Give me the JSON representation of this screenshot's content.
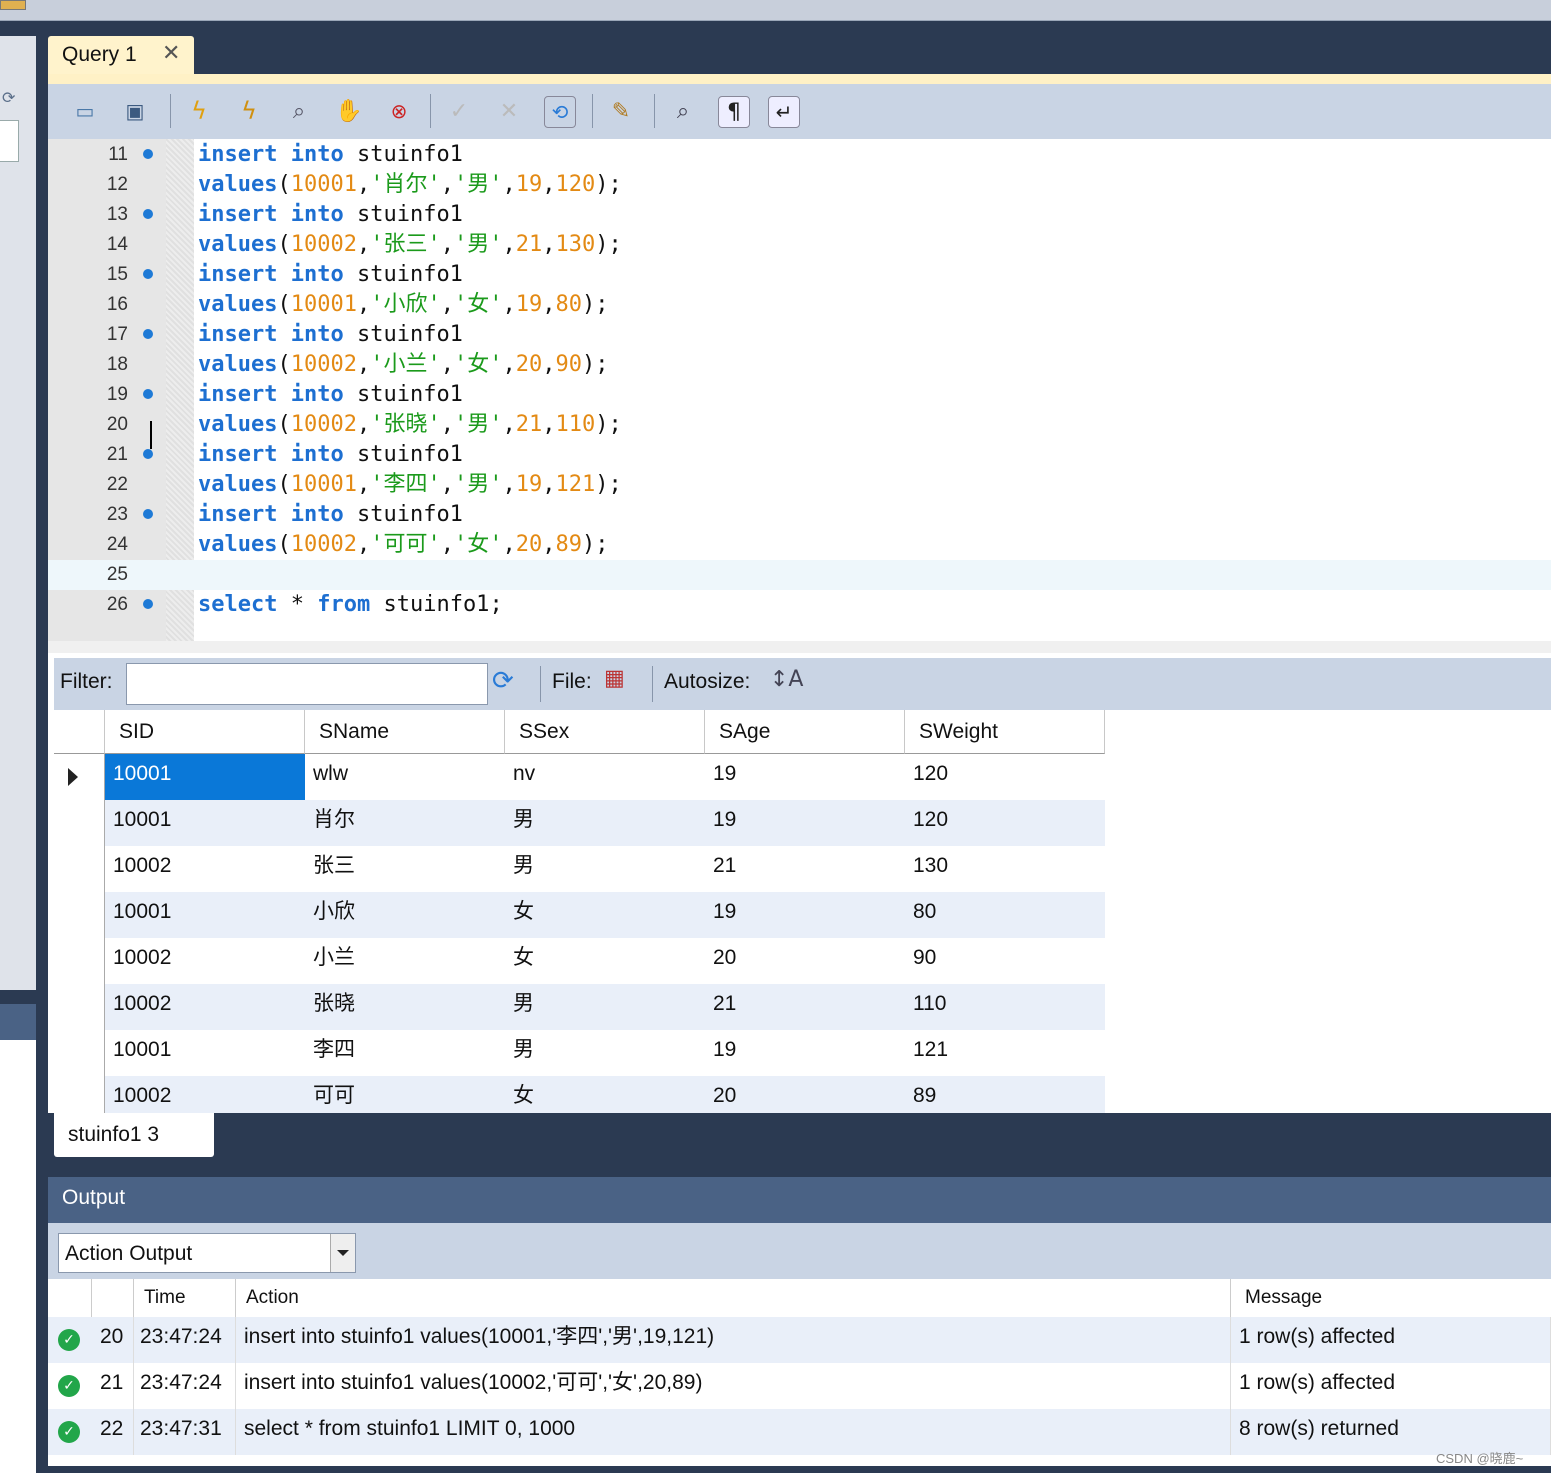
{
  "query_tab": {
    "label": "Query 1",
    "close": "✕"
  },
  "toolbar": {
    "icons": [
      "open-folder-icon",
      "save-icon",
      "execute-icon",
      "execute-current-icon",
      "explain-icon",
      "stop-icon",
      "toggle-error-icon",
      "commit-icon",
      "rollback-icon",
      "autocommit-icon",
      "beautify-icon",
      "find-icon",
      "invisible-chars-icon",
      "word-wrap-icon"
    ]
  },
  "editor": {
    "lines": [
      {
        "n": "11",
        "dot": true
      },
      {
        "n": "12",
        "dot": false
      },
      {
        "n": "13",
        "dot": true
      },
      {
        "n": "14",
        "dot": false
      },
      {
        "n": "15",
        "dot": true
      },
      {
        "n": "16",
        "dot": false
      },
      {
        "n": "17",
        "dot": true
      },
      {
        "n": "18",
        "dot": false
      },
      {
        "n": "19",
        "dot": true
      },
      {
        "n": "20",
        "dot": false
      },
      {
        "n": "21",
        "dot": true
      },
      {
        "n": "22",
        "dot": false
      },
      {
        "n": "23",
        "dot": true
      },
      {
        "n": "24",
        "dot": false
      },
      {
        "n": "25",
        "dot": false
      },
      {
        "n": "26",
        "dot": true
      }
    ],
    "insert_kw": "insert",
    "into_kw": "into",
    "table": "stuinfo1",
    "values_kw": "values",
    "select_kw": "select",
    "star": "*",
    "from_kw": "from",
    "stmts": [
      {
        "sid": "10001",
        "name": "'肖尔'",
        "sex": "'男'",
        "age": "19",
        "weight": "120"
      },
      {
        "sid": "10002",
        "name": "'张三'",
        "sex": "'男'",
        "age": "21",
        "weight": "130"
      },
      {
        "sid": "10001",
        "name": "'小欣'",
        "sex": "'女'",
        "age": "19",
        "weight": "80"
      },
      {
        "sid": "10002",
        "name": "'小兰'",
        "sex": "'女'",
        "age": "20",
        "weight": "90"
      },
      {
        "sid": "10002",
        "name": "'张晓'",
        "sex": "'男'",
        "age": "21",
        "weight": "110"
      },
      {
        "sid": "10001",
        "name": "'李四'",
        "sex": "'男'",
        "age": "19",
        "weight": "121"
      },
      {
        "sid": "10002",
        "name": "'可可'",
        "sex": "'女'",
        "age": "20",
        "weight": "89"
      }
    ]
  },
  "filter_bar": {
    "filter_label": "Filter:",
    "filter_value": "",
    "file_label": "File:",
    "autosize_label": "Autosize:"
  },
  "grid": {
    "columns": [
      "SID",
      "SName",
      "SSex",
      "SAge",
      "SWeight"
    ],
    "rows": [
      [
        "10001",
        "wlw",
        "nv",
        "19",
        "120"
      ],
      [
        "10001",
        "肖尔",
        "男",
        "19",
        "120"
      ],
      [
        "10002",
        "张三",
        "男",
        "21",
        "130"
      ],
      [
        "10001",
        "小欣",
        "女",
        "19",
        "80"
      ],
      [
        "10002",
        "小兰",
        "女",
        "20",
        "90"
      ],
      [
        "10002",
        "张晓",
        "男",
        "21",
        "110"
      ],
      [
        "10001",
        "李四",
        "男",
        "19",
        "121"
      ],
      [
        "10002",
        "可可",
        "女",
        "20",
        "89"
      ]
    ]
  },
  "result_tab": {
    "label": "stuinfo1 3"
  },
  "output": {
    "title": "Output",
    "select_value": "Action Output",
    "columns": [
      "",
      "Time",
      "Action",
      "Message"
    ],
    "rows": [
      {
        "n": "20",
        "time": "23:47:24",
        "action": "insert into stuinfo1 values(10001,'李四','男',19,121)",
        "message": "1 row(s) affected"
      },
      {
        "n": "21",
        "time": "23:47:24",
        "action": "insert into stuinfo1 values(10002,'可可','女',20,89)",
        "message": "1 row(s) affected"
      },
      {
        "n": "22",
        "time": "23:47:31",
        "action": "select * from stuinfo1 LIMIT 0, 1000",
        "message": "8 row(s) returned"
      }
    ]
  },
  "watermark": "CSDN @晓鹿~"
}
